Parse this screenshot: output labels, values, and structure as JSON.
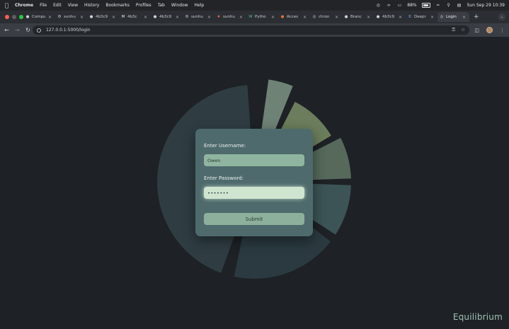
{
  "menubar": {
    "app": "Chrome",
    "items": [
      "File",
      "Edit",
      "View",
      "History",
      "Bookmarks",
      "Profiles",
      "Tab",
      "Window",
      "Help"
    ],
    "battery_percent": "88%",
    "battery_level": 0.88,
    "datetime": "Sun Sep 29  10:39"
  },
  "tabs": [
    {
      "icon": "github-icon",
      "label": "Compu"
    },
    {
      "icon": "gear-icon",
      "label": "sunhu"
    },
    {
      "icon": "github-icon",
      "label": "4b3c9"
    },
    {
      "icon": "gmail-icon",
      "label": "4b3c"
    },
    {
      "icon": "github-icon",
      "label": "4b3c9"
    },
    {
      "icon": "gear-icon",
      "label": "sunhu"
    },
    {
      "icon": "app-icon",
      "label": "sunhu"
    },
    {
      "icon": "w-icon",
      "label": "Pytho"
    },
    {
      "icon": "access-icon",
      "label": "Acces"
    },
    {
      "icon": "chrome-icon",
      "label": "chron"
    },
    {
      "icon": "github-icon",
      "label": "Branc"
    },
    {
      "icon": "github-icon",
      "label": "4b3c9"
    },
    {
      "icon": "b-icon",
      "label": "Deepr"
    },
    {
      "icon": "globe-icon",
      "label": "Login",
      "active": true
    }
  ],
  "toolbar": {
    "url": "127.0.0.1:5000/login"
  },
  "login": {
    "username_label": "Enter Username:",
    "username_value": "Owen",
    "password_label": "Enter Password:",
    "password_value": "•••••••",
    "submit_label": "Submit"
  },
  "brand": "Equilibrium",
  "colors": {
    "page_bg": "#1e2125",
    "card_bg": "#4e6a6c",
    "input_bg": "#8fb5a0",
    "focused_input_bg": "#cfe5d0",
    "button_bg": "#8db09c",
    "brand_text": "#9fc2b4"
  }
}
